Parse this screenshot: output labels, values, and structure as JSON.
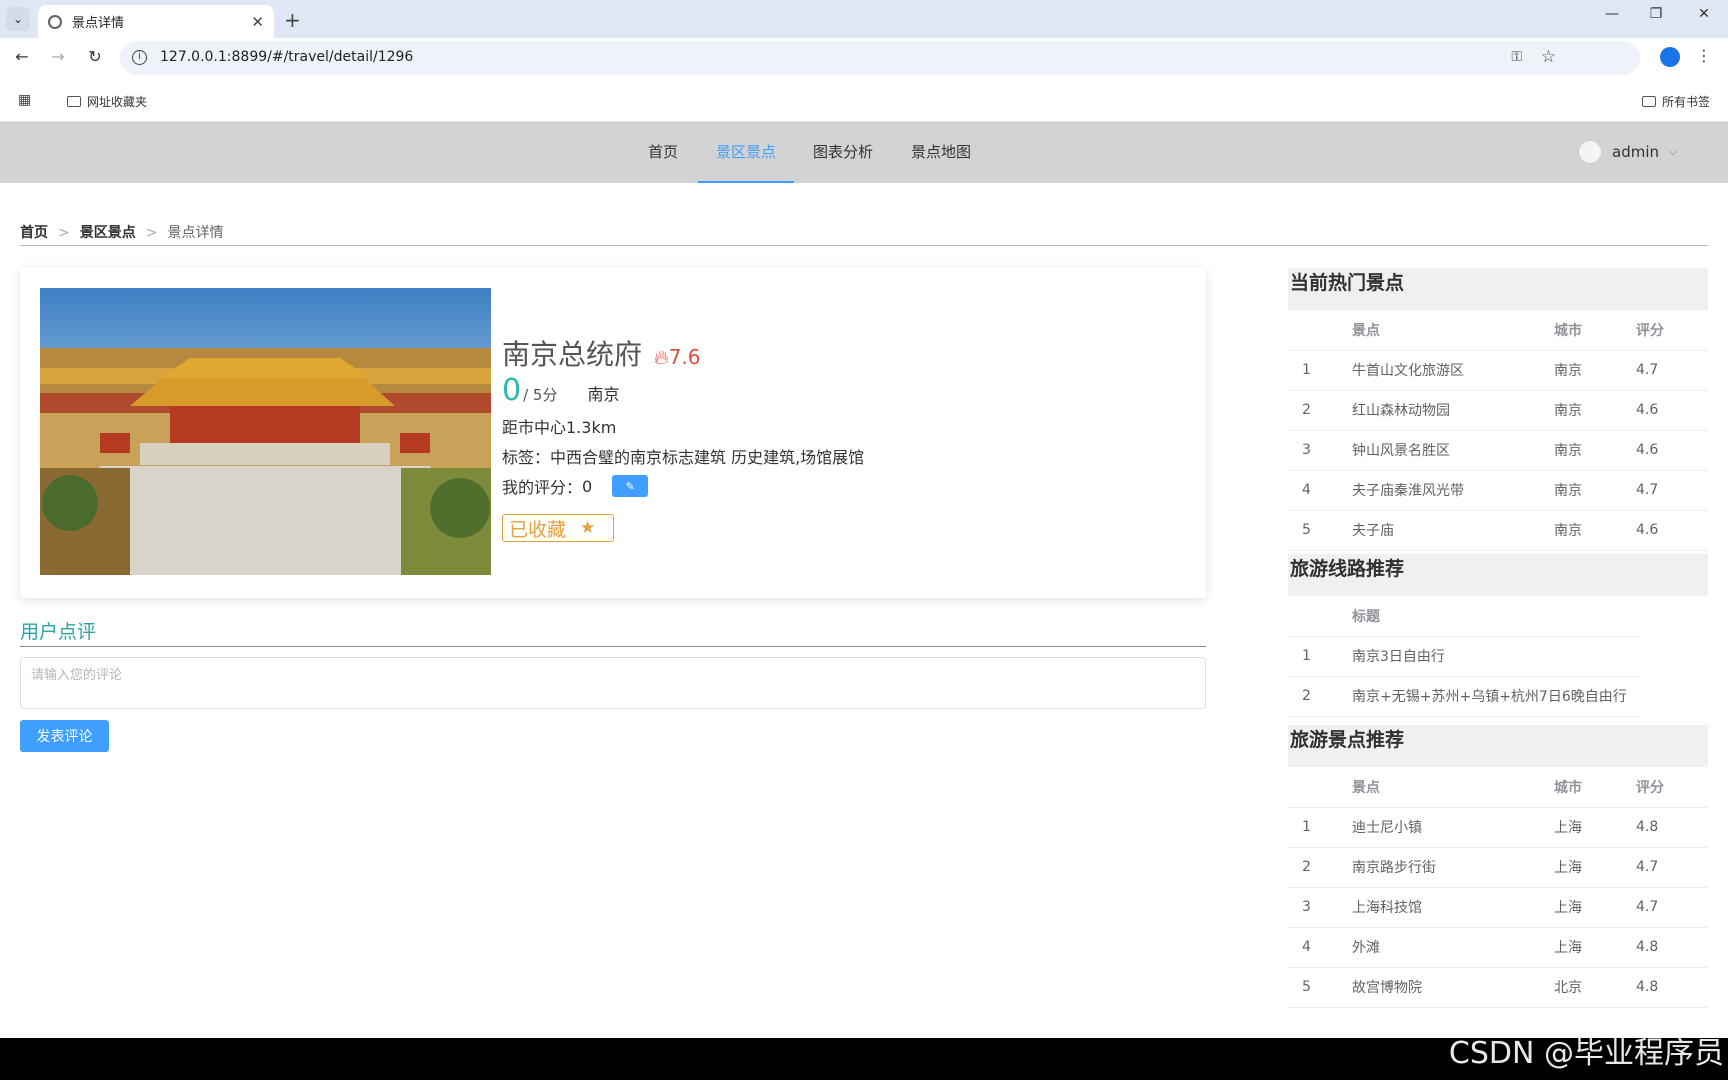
{
  "browser": {
    "tab_title": "景点详情",
    "url": "127.0.0.1:8899/#/travel/detail/1296",
    "bookmark_folder": "网址收藏夹",
    "all_bookmarks": "所有书签"
  },
  "nav": {
    "items": [
      "首页",
      "景区景点",
      "图表分析",
      "景点地图"
    ],
    "active_index": 1,
    "user": "admin"
  },
  "breadcrumb": [
    "首页",
    "景区景点",
    "景点详情"
  ],
  "spot": {
    "name": "南京总统府",
    "hot": "7.6",
    "score": "0",
    "score_suffix": "/ 5分",
    "city": "南京",
    "distance": "距市中心1.3km",
    "tags": "标签：中西合璧的南京标志建筑 历史建筑,场馆展馆",
    "my_score_label": "我的评分：",
    "my_score": "0",
    "fav_label": "已收藏"
  },
  "comments": {
    "title": "用户点评",
    "placeholder": "请输入您的评论",
    "submit": "发表评论"
  },
  "hot_spots": {
    "title": "当前热门景点",
    "headers": [
      "景点",
      "城市",
      "评分"
    ],
    "rows": [
      [
        "1",
        "牛首山文化旅游区",
        "南京",
        "4.7"
      ],
      [
        "2",
        "红山森林动物园",
        "南京",
        "4.6"
      ],
      [
        "3",
        "钟山风景名胜区",
        "南京",
        "4.6"
      ],
      [
        "4",
        "夫子庙秦淮风光带",
        "南京",
        "4.7"
      ],
      [
        "5",
        "夫子庙",
        "南京",
        "4.6"
      ]
    ]
  },
  "routes": {
    "title": "旅游线路推荐",
    "headers": [
      "标题"
    ],
    "rows": [
      [
        "1",
        "南京3日自由行"
      ],
      [
        "2",
        "南京+无锡+苏州+乌镇+杭州7日6晚自由行"
      ]
    ]
  },
  "recommend": {
    "title": "旅游景点推荐",
    "headers": [
      "景点",
      "城市",
      "评分"
    ],
    "rows": [
      [
        "1",
        "迪士尼小镇",
        "上海",
        "4.8"
      ],
      [
        "2",
        "南京路步行街",
        "上海",
        "4.7"
      ],
      [
        "3",
        "上海科技馆",
        "上海",
        "4.7"
      ],
      [
        "4",
        "外滩",
        "上海",
        "4.8"
      ],
      [
        "5",
        "故宫博物院",
        "北京",
        "4.8"
      ]
    ]
  },
  "watermark": "CSDN @毕业程序员"
}
